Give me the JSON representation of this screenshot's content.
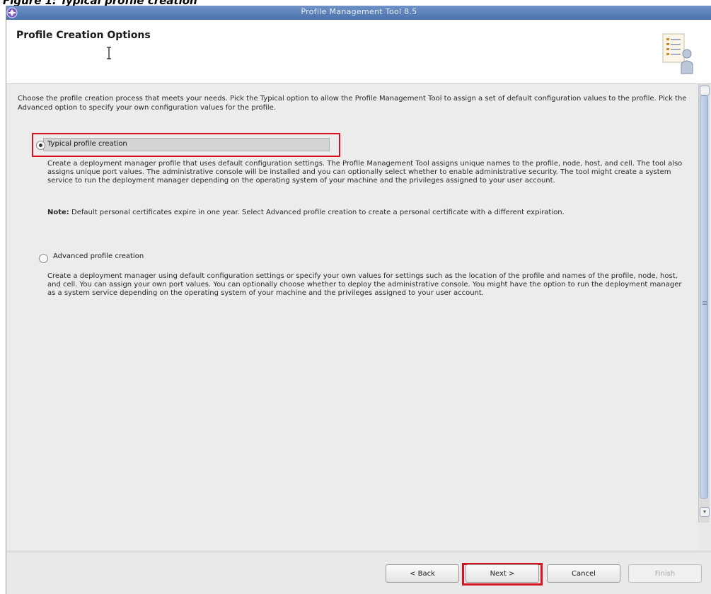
{
  "caption": {
    "text": "Figure 1: Typical profile creation"
  },
  "window": {
    "title": "Profile Management Tool 8.5"
  },
  "header": {
    "page_title": "Profile Creation Options"
  },
  "content": {
    "intro": "Choose the profile creation process that meets your needs. Pick the Typical option to allow the Profile Management Tool to assign a set of default configuration values to the profile. Pick the Advanced option to specify your own configuration values for the profile.",
    "options": [
      {
        "label": "Typical profile creation",
        "selected": true,
        "description": "Create a deployment manager profile that uses default configuration settings. The Profile Management Tool assigns unique names to the profile, node, host, and cell. The tool also assigns unique port values. The administrative console will be installed and you can optionally select whether to enable administrative security. The tool might create a system service to run the deployment manager depending on the operating system of your machine and the privileges assigned to your user account.",
        "note_label": "Note:",
        "note_text": "Default personal certificates expire in one year. Select Advanced profile creation to create a personal certificate with a different expiration."
      },
      {
        "label": "Advanced profile creation",
        "selected": false,
        "description": "Create a deployment manager using default configuration settings or specify your own values for settings such as the location of the profile and names of the profile, node, host, and cell. You can assign your own port values. You can optionally choose whether to deploy the administrative console. You might have the option to run the deployment manager as a system service depending on the operating system of your machine and the privileges assigned to your user account."
      }
    ]
  },
  "buttons": {
    "back": "< Back",
    "next": "Next >",
    "cancel": "Cancel",
    "finish": "Finish"
  },
  "colors": {
    "highlight": "#d9121f",
    "titlebar": "#4a72ad"
  },
  "icons": {
    "app": "app-logo-icon",
    "wizard": "wizard-document-person-icon",
    "cursor": "text-cursor-icon"
  }
}
